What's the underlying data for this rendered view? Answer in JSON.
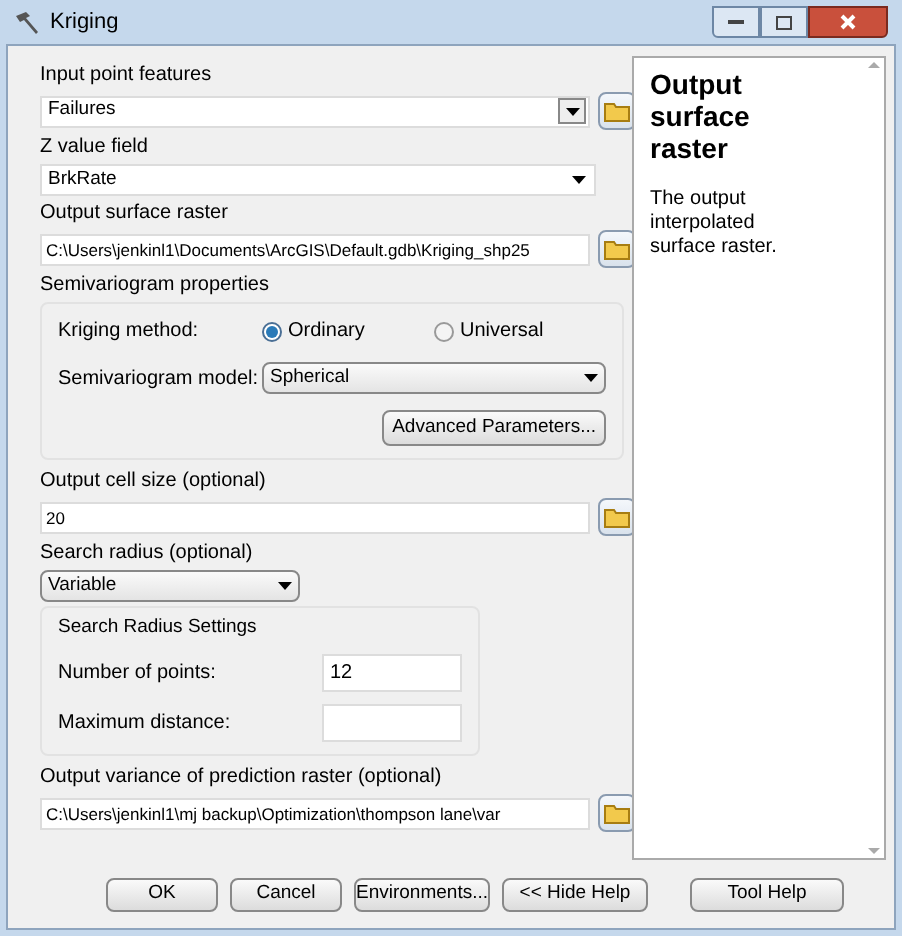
{
  "window": {
    "title": "Kriging"
  },
  "params_top": [
    {
      "kind": "combo_browse",
      "label": "Input point features",
      "value": "Failures"
    },
    {
      "kind": "dropdown",
      "label": "Z value field",
      "value": "BrkRate"
    },
    {
      "kind": "text_browse",
      "label": "Output surface raster",
      "value": "C:\\Users\\jenkinl1\\Documents\\ArcGIS\\Default.gdb\\Kriging_shp25"
    }
  ],
  "semivariogram": {
    "label": "Semivariogram properties",
    "method_label": "Kriging method:",
    "methods": [
      {
        "label": "Ordinary",
        "selected": true
      },
      {
        "label": "Universal",
        "selected": false
      }
    ],
    "model_label": "Semivariogram model:",
    "model_value": "Spherical",
    "advanced_button": "Advanced Parameters..."
  },
  "cell_size": {
    "label": "Output cell size (optional)",
    "value": "20"
  },
  "search_radius": {
    "label": "Search radius (optional)",
    "value": "Variable",
    "settings_label": "Search Radius Settings",
    "fields": [
      {
        "label": "Number of points:",
        "value": "12"
      },
      {
        "label": "Maximum distance:"
      }
    ]
  },
  "variance": {
    "label": "Output variance of prediction raster (optional)",
    "value": "C:\\Users\\jenkinl1\\mj backup\\Optimization\\thompson lane\\var"
  },
  "help": {
    "title": "Output surface raster",
    "text": "The output interpolated surface raster."
  },
  "buttons": [
    "OK",
    "Cancel",
    "Environments...",
    "<< Hide Help",
    "Tool Help"
  ]
}
